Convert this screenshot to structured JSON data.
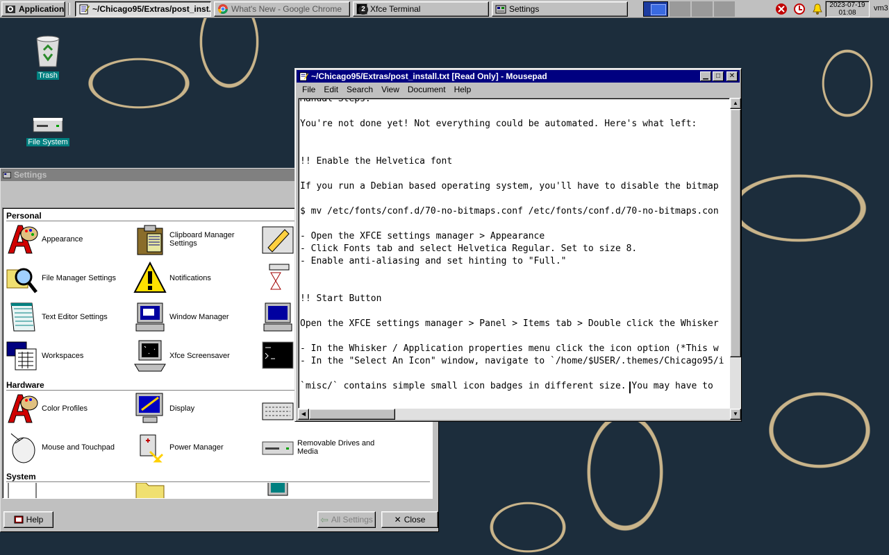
{
  "taskbar": {
    "apps_label": "Applications",
    "tasks": [
      {
        "label": "~/Chicago95/Extras/post_inst...",
        "icon": "text-editor-icon",
        "active": true
      },
      {
        "label": "What's New - Google Chrome",
        "icon": "chrome-icon",
        "active": false
      },
      {
        "label": "Xfce Terminal",
        "icon": "terminal-icon",
        "badge": "2",
        "active": false
      },
      {
        "label": "Settings",
        "icon": "settings-icon",
        "active": false
      }
    ],
    "clock_date": "2023-07-19",
    "clock_time": "01:08",
    "user": "vm3"
  },
  "desktop": {
    "icons": [
      {
        "label": "Trash",
        "icon": "recycle-bin-icon"
      },
      {
        "label": "File System",
        "icon": "drive-icon"
      }
    ]
  },
  "settings": {
    "title": "Settings",
    "categories": [
      {
        "name": "Personal",
        "items": [
          "Appearance",
          "Clipboard Manager Settings",
          "File Manager Settings",
          "Notifications",
          "Text Editor Settings",
          "Window Manager",
          "Workspaces",
          "Xfce Screensaver"
        ]
      },
      {
        "name": "Hardware",
        "items": [
          "Color Profiles",
          "Display",
          "Mouse and Touchpad",
          "Power Manager",
          "Removable Drives and Media"
        ]
      },
      {
        "name": "System",
        "items": []
      }
    ],
    "buttons": {
      "help": "Help",
      "all_settings": "All Settings",
      "close": "Close"
    }
  },
  "mousepad": {
    "title": "~/Chicago95/Extras/post_install.txt [Read Only] - Mousepad",
    "menu": [
      "File",
      "Edit",
      "Search",
      "View",
      "Document",
      "Help"
    ],
    "lines": [
      "Manual Steps:",
      "",
      "You're not done yet! Not everything could be automated. Here's what left:",
      "",
      "",
      "!! Enable the Helvetica font",
      "",
      "If you run a Debian based operating system, you'll have to disable the bitmap",
      "",
      "$ mv /etc/fonts/conf.d/70-no-bitmaps.conf /etc/fonts/conf.d/70-no-bitmaps.con",
      "",
      "- Open the XFCE settings manager > Appearance",
      "- Click Fonts tab and select Helvetica Regular. Set to size 8.",
      "- Enable anti-aliasing and set hinting to \"Full.\"",
      "",
      "",
      "!! Start Button",
      "",
      "Open the XFCE settings manager > Panel > Items tab > Double click the Whisker",
      "",
      "- In the Whisker / Application properties menu click the icon option (*This w",
      "- In the \"Select An Icon\" window, navigate to `/home/$USER/.themes/Chicago95/i",
      "",
      "`misc/` contains simple small icon badges in different size. You may have to"
    ]
  }
}
